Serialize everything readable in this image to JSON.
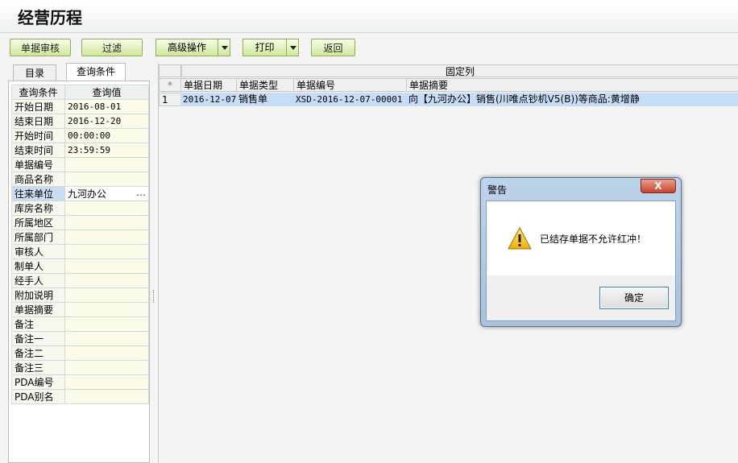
{
  "window": {
    "title": "经营历程"
  },
  "toolbar": {
    "review": "单据审核",
    "filter": "过滤",
    "advanced": "高级操作",
    "print": "打印",
    "back": "返回"
  },
  "tabs": {
    "catalog": "目录",
    "query": "查询条件"
  },
  "conditions": {
    "header_name": "查询条件",
    "header_value": "查询值",
    "rows": [
      {
        "label": "开始日期",
        "value": "2016-08-01"
      },
      {
        "label": "结束日期",
        "value": "2016-12-20"
      },
      {
        "label": "开始时间",
        "value": "00:00:00"
      },
      {
        "label": "结束时间",
        "value": "23:59:59"
      },
      {
        "label": "单据编号",
        "value": ""
      },
      {
        "label": "商品名称",
        "value": ""
      },
      {
        "label": "往来单位",
        "value": "九河办公",
        "ellipsis": "…"
      },
      {
        "label": "库房名称",
        "value": ""
      },
      {
        "label": "所属地区",
        "value": ""
      },
      {
        "label": "所属部门",
        "value": ""
      },
      {
        "label": "审核人",
        "value": ""
      },
      {
        "label": "制单人",
        "value": ""
      },
      {
        "label": "经手人",
        "value": ""
      },
      {
        "label": "附加说明",
        "value": ""
      },
      {
        "label": "单据摘要",
        "value": ""
      },
      {
        "label": "备注",
        "value": ""
      },
      {
        "label": "备注一",
        "value": ""
      },
      {
        "label": "备注二",
        "value": ""
      },
      {
        "label": "备注三",
        "value": ""
      },
      {
        "label": "PDA编号",
        "value": ""
      },
      {
        "label": "PDA别名",
        "value": ""
      }
    ]
  },
  "grid": {
    "fixed_header": "固定列",
    "corner": "*",
    "columns": [
      "单据日期",
      "单据类型",
      "单据编号",
      "单据摘要"
    ],
    "rows": [
      {
        "index": "1",
        "date": "2016-12-07",
        "type": "销售单",
        "number": "XSD-2016-12-07-00001",
        "summary": "向【九河办公】销售(川唯点钞机V5(B))等商品:黄增静"
      }
    ]
  },
  "dialog": {
    "title": "警告",
    "close": "X",
    "message": "已结存单据不允许红冲！",
    "ok": "确定"
  }
}
